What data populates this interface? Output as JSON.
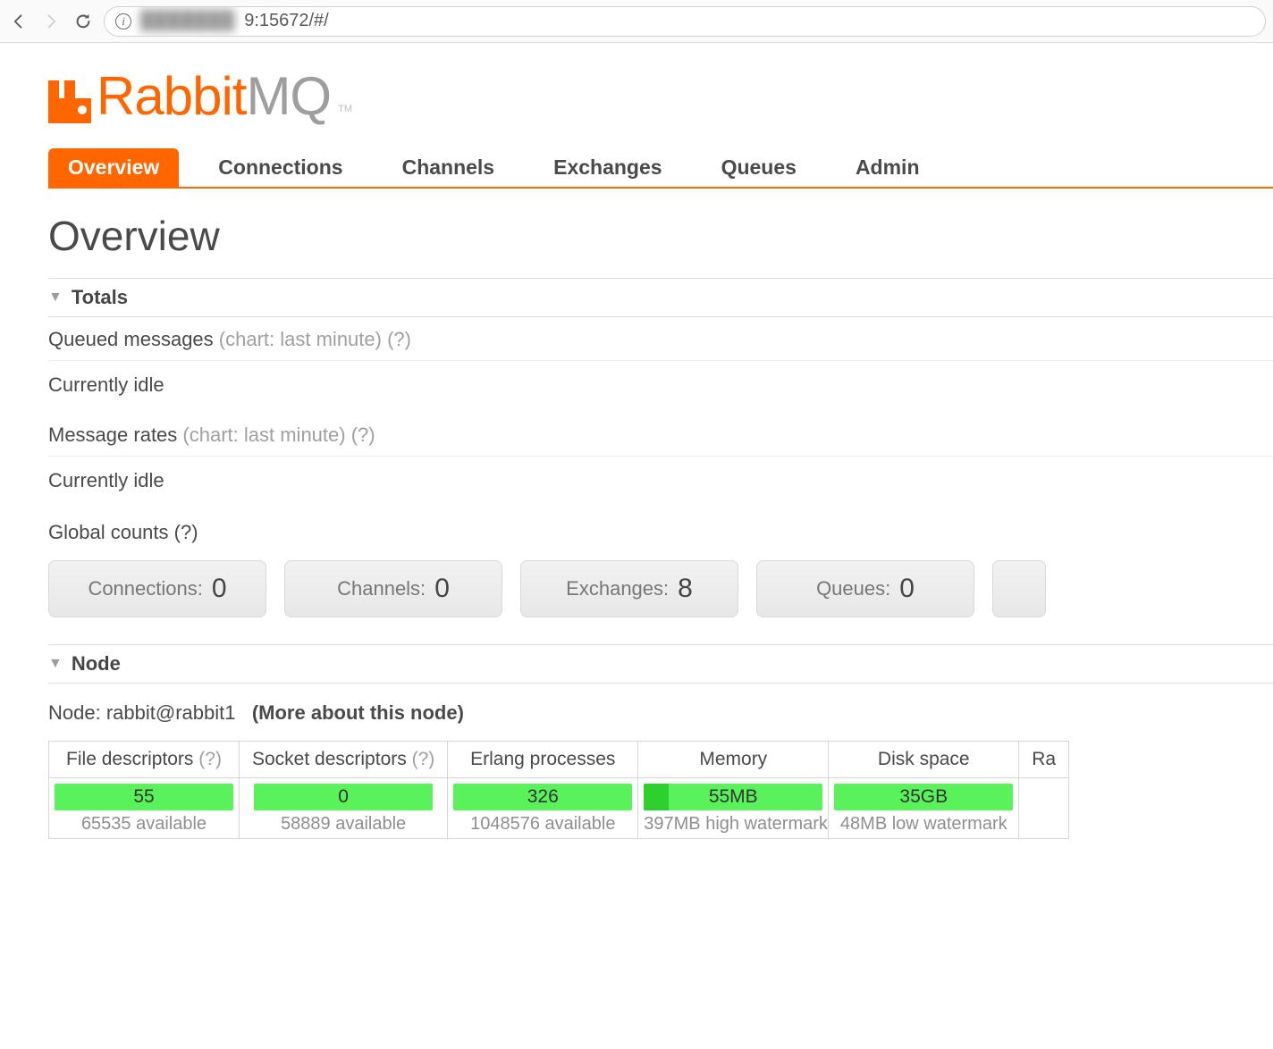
{
  "browser": {
    "url_obscured": "███████",
    "url_suffix": "9:15672/#/"
  },
  "logo": {
    "part1": "Rabbit",
    "part2": "MQ"
  },
  "tabs": {
    "overview": "Overview",
    "connections": "Connections",
    "channels": "Channels",
    "exchanges": "Exchanges",
    "queues": "Queues",
    "admin": "Admin"
  },
  "page_title": "Overview",
  "sections": {
    "totals": "Totals",
    "node": "Node"
  },
  "totals": {
    "queued_label": "Queued messages",
    "queued_hint": "(chart: last minute) (?)",
    "queued_idle": "Currently idle",
    "rates_label": "Message rates",
    "rates_hint": "(chart: last minute) (?)",
    "rates_idle": "Currently idle",
    "global_label": "Global counts",
    "global_hint": "(?)"
  },
  "counts": {
    "connections_label": "Connections:",
    "connections_value": "0",
    "channels_label": "Channels:",
    "channels_value": "0",
    "exchanges_label": "Exchanges:",
    "exchanges_value": "8",
    "queues_label": "Queues:",
    "queues_value": "0"
  },
  "node": {
    "prefix": "Node: ",
    "name": "rabbit@rabbit1",
    "more": "(More about this node)",
    "headers": {
      "fd": "File descriptors",
      "fd_hint": "(?)",
      "sd": "Socket descriptors",
      "sd_hint": "(?)",
      "ep": "Erlang processes",
      "mem": "Memory",
      "disk": "Disk space",
      "extra": "Ra"
    },
    "stats": {
      "fd_val": "55",
      "fd_sub": "65535 available",
      "sd_val": "0",
      "sd_sub": "58889 available",
      "ep_val": "326",
      "ep_sub": "1048576 available",
      "mem_val": "55MB",
      "mem_sub": "397MB high watermark",
      "mem_fill_pct": 14,
      "disk_val": "35GB",
      "disk_sub": "48MB low watermark"
    }
  }
}
